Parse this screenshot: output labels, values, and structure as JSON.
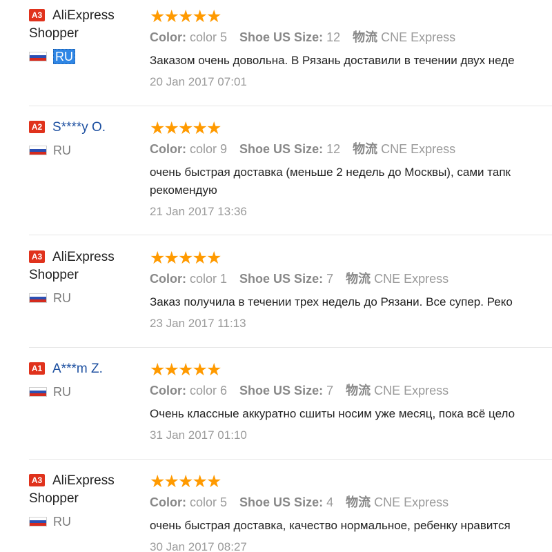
{
  "reviews": [
    {
      "level": "A3",
      "name_line1": "AliExpress",
      "name_line2": "Shopper",
      "country": "RU",
      "country_selected": true,
      "stars": 5,
      "color_label": "Color:",
      "color_value": "color 5",
      "size_label": "Shoe US Size:",
      "size_value": "12",
      "logistics_label": "物流",
      "logistics_value": "CNE Express",
      "content_lines": [
        "Заказом очень довольна. В Рязань доставили в течении двух неде"
      ],
      "date": "20 Jan 2017 07:01"
    },
    {
      "level": "A2",
      "name_line1": "S****y O.",
      "name_line2": "",
      "country": "RU",
      "country_selected": false,
      "stars": 5,
      "color_label": "Color:",
      "color_value": "color 9",
      "size_label": "Shoe US Size:",
      "size_value": "12",
      "logistics_label": "物流",
      "logistics_value": "CNE Express",
      "content_lines": [
        "очень быстрая доставка (меньше 2 недель до Москвы), сами тапк",
        "рекомендую"
      ],
      "date": "21 Jan 2017 13:36"
    },
    {
      "level": "A3",
      "name_line1": "AliExpress",
      "name_line2": "Shopper",
      "country": "RU",
      "country_selected": false,
      "stars": 5,
      "color_label": "Color:",
      "color_value": "color 1",
      "size_label": "Shoe US Size:",
      "size_value": "7",
      "logistics_label": "物流",
      "logistics_value": "CNE Express",
      "content_lines": [
        "Заказ получила в течении трех недель до Рязани. Все супер. Реко"
      ],
      "date": "23 Jan 2017 11:13"
    },
    {
      "level": "A1",
      "name_line1": "A***m Z.",
      "name_line2": "",
      "country": "RU",
      "country_selected": false,
      "stars": 5,
      "color_label": "Color:",
      "color_value": "color 6",
      "size_label": "Shoe US Size:",
      "size_value": "7",
      "logistics_label": "物流",
      "logistics_value": "CNE Express",
      "content_lines": [
        "Очень классные аккуратно сшиты носим уже месяц, пока всё цело"
      ],
      "date": "31 Jan 2017 01:10"
    },
    {
      "level": "A3",
      "name_line1": "AliExpress",
      "name_line2": "Shopper",
      "country": "RU",
      "country_selected": false,
      "stars": 5,
      "color_label": "Color:",
      "color_value": "color 5",
      "size_label": "Shoe US Size:",
      "size_value": "4",
      "logistics_label": "物流",
      "logistics_value": "CNE Express",
      "content_lines": [
        "очень быстрая доставка, качество нормальное, ребенку нравится"
      ],
      "date": "30 Jan 2017 08:27"
    }
  ],
  "colors": {
    "badge": "#e0321c",
    "star": "#ff9a00",
    "masked_name": "#1c4fa0",
    "selection": "#2f86e5"
  }
}
